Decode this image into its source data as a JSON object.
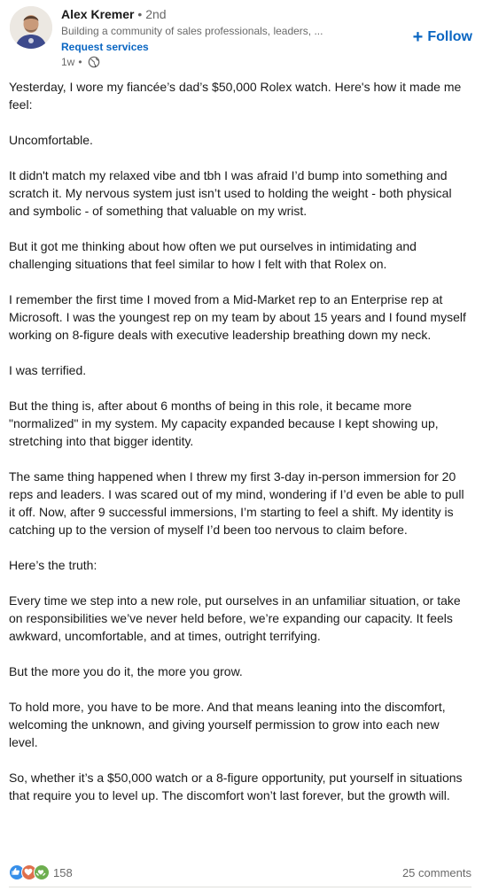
{
  "author": {
    "name": "Alex Kremer",
    "dot": "•",
    "degree": "2nd",
    "headline": "Building a community of sales professionals, leaders, ...",
    "cta": "Request services",
    "time": "1w",
    "time_sep": "•",
    "visibility_icon": "globe-icon"
  },
  "follow": {
    "icon": "plus-icon",
    "plus": "+",
    "label": "Follow",
    "color": "#0a66c2"
  },
  "post": {
    "paragraphs": [
      "Yesterday, I wore my fiancée’s dad’s $50,000 Rolex watch. Here's how it made me feel:",
      "Uncomfortable.",
      "It didn't match my relaxed vibe and tbh I was afraid I’d bump into something and scratch it. My nervous system just isn’t used to holding the weight - both physical and symbolic - of something that valuable on my wrist.",
      "But it got me thinking about how often we put ourselves in intimidating and challenging situations that feel similar to how I felt with that Rolex on.",
      "I remember the first time I moved from a Mid-Market rep to an Enterprise rep at Microsoft. I was the youngest rep on my team by about 15 years and I found myself working on 8-figure deals with executive leadership breathing down my neck.",
      "I was terrified.",
      "But the thing is, after about 6 months of being in this role, it became more \"normalized\" in my system. My capacity expanded because I kept showing up, stretching into that bigger identity.",
      "The same thing happened when I threw my first 3-day in-person immersion for 20 reps and leaders. I was scared out of my mind, wondering if I’d even be able to pull it off. Now, after 9 successful immersions, I’m starting to feel a shift. My identity is catching up to the version of myself I’d been too nervous to claim before.",
      "Here’s the truth:",
      "Every time we step into a new role, put ourselves in an unfamiliar situation, or take on responsibilities we’ve never held before, we’re expanding our capacity. It feels awkward, uncomfortable, and at times, outright terrifying.",
      "But the more you do it, the more you grow.",
      "To hold more, you have to be more. And that means leaning into the discomfort, welcoming the unknown, and giving yourself permission to grow into each new level.",
      "So, whether it’s a $50,000 watch or a 8-figure opportunity, put yourself in situations that require you to level up. The discomfort won’t last forever, but the growth will."
    ]
  },
  "social": {
    "reactions": [
      {
        "icon": "like-icon",
        "color": "#378fe9"
      },
      {
        "icon": "love-icon",
        "color": "#df704d"
      },
      {
        "icon": "support-icon",
        "color": "#6dae4f"
      }
    ],
    "reaction_count": "158",
    "comments": "25 comments"
  },
  "colors": {
    "brand": "#0a66c2",
    "text": "rgba(0,0,0,0.9)",
    "muted": "rgba(0,0,0,0.6)"
  }
}
